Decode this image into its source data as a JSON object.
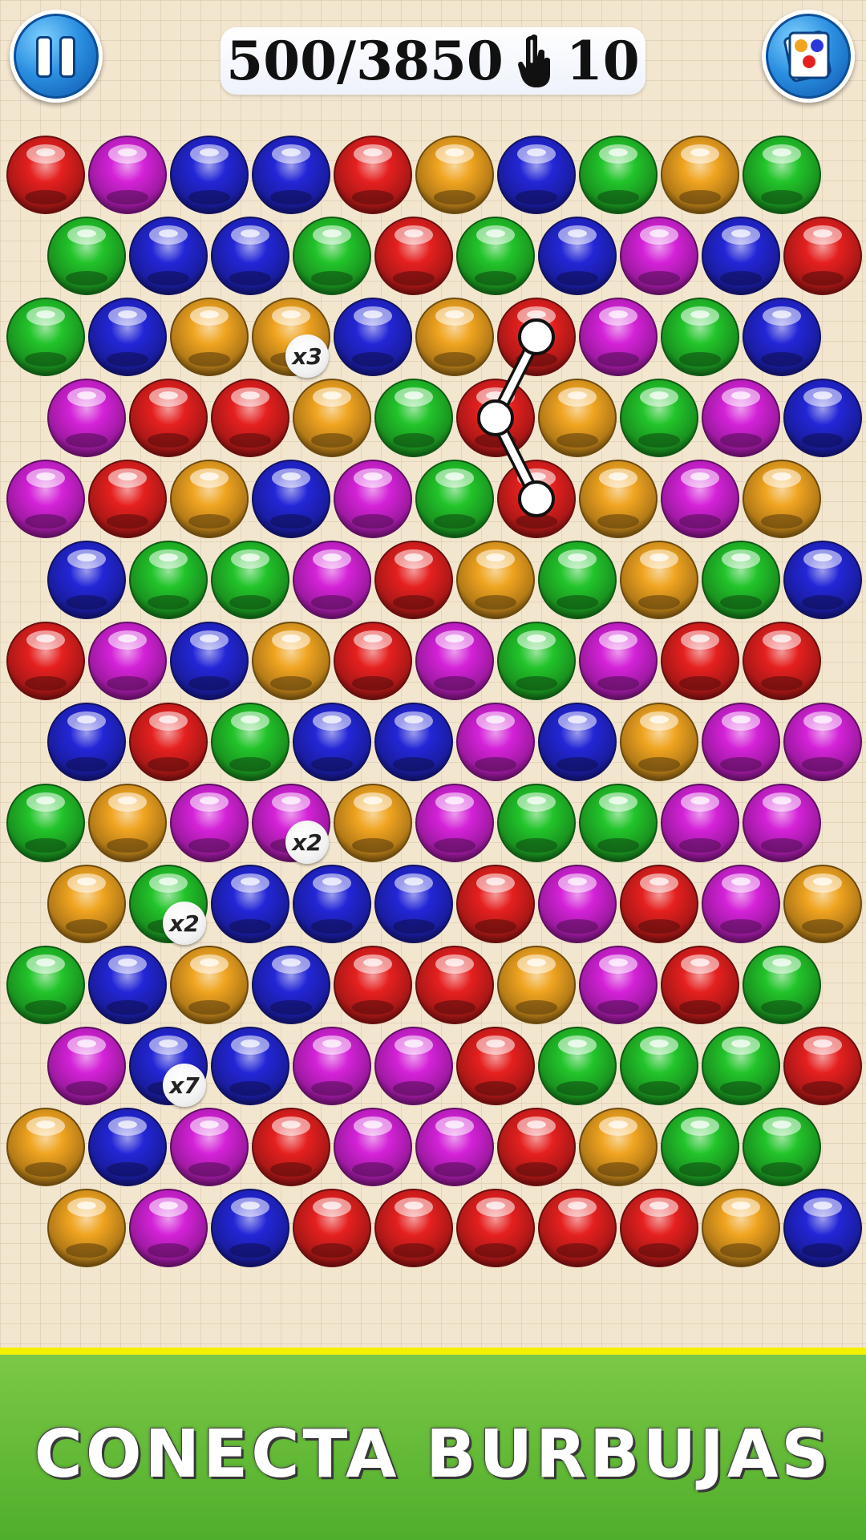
{
  "header": {
    "pause_icon": "pause-icon",
    "colors_icon": "color-cards-icon",
    "score": "500/3850",
    "moves_icon": "hand-pointer-icon",
    "moves": "10"
  },
  "board": {
    "colors": {
      "R": "#e5201f",
      "M": "#d422d8",
      "B": "#2326d6",
      "G": "#22c42a",
      "Y": "#f0a420"
    },
    "rows": [
      [
        "R",
        "M",
        "B",
        "B",
        "R",
        "Y",
        "B",
        "G",
        "Y",
        "G"
      ],
      [
        "G",
        "B",
        "B",
        "G",
        "R",
        "G",
        "B",
        "M",
        "B",
        "R"
      ],
      [
        "G",
        "B",
        "Y",
        "Y",
        "B",
        "Y",
        "R",
        "M",
        "G",
        "B"
      ],
      [
        "M",
        "R",
        "R",
        "Y",
        "G",
        "R",
        "Y",
        "G",
        "M",
        "B"
      ],
      [
        "M",
        "R",
        "Y",
        "B",
        "M",
        "G",
        "R",
        "Y",
        "M",
        "Y"
      ],
      [
        "B",
        "G",
        "G",
        "M",
        "R",
        "Y",
        "G",
        "Y",
        "G",
        "B"
      ],
      [
        "R",
        "M",
        "B",
        "Y",
        "R",
        "M",
        "G",
        "M",
        "R",
        "R"
      ],
      [
        "B",
        "R",
        "G",
        "B",
        "B",
        "M",
        "B",
        "Y",
        "M",
        "M"
      ],
      [
        "G",
        "Y",
        "M",
        "M",
        "Y",
        "M",
        "G",
        "G",
        "M",
        "M"
      ],
      [
        "Y",
        "G",
        "B",
        "B",
        "B",
        "R",
        "M",
        "R",
        "M",
        "Y"
      ],
      [
        "G",
        "B",
        "Y",
        "B",
        "R",
        "R",
        "Y",
        "M",
        "R",
        "G"
      ],
      [
        "M",
        "B",
        "B",
        "M",
        "M",
        "R",
        "G",
        "G",
        "G",
        "R"
      ],
      [
        "Y",
        "B",
        "M",
        "R",
        "M",
        "M",
        "R",
        "Y",
        "G",
        "G"
      ],
      [
        "Y",
        "M",
        "B",
        "R",
        "R",
        "R",
        "R",
        "R",
        "Y",
        "B"
      ]
    ],
    "multipliers": [
      {
        "row": 2,
        "col": 3,
        "label": "x3"
      },
      {
        "row": 8,
        "col": 3,
        "label": "x2"
      },
      {
        "row": 9,
        "col": 1,
        "label": "x2"
      },
      {
        "row": 11,
        "col": 1,
        "label": "x7"
      }
    ],
    "selection": [
      {
        "row": 2,
        "col": 6
      },
      {
        "row": 3,
        "col": 5
      },
      {
        "row": 4,
        "col": 6
      }
    ]
  },
  "banner": {
    "title": "CONECTA BURBUJAS"
  }
}
